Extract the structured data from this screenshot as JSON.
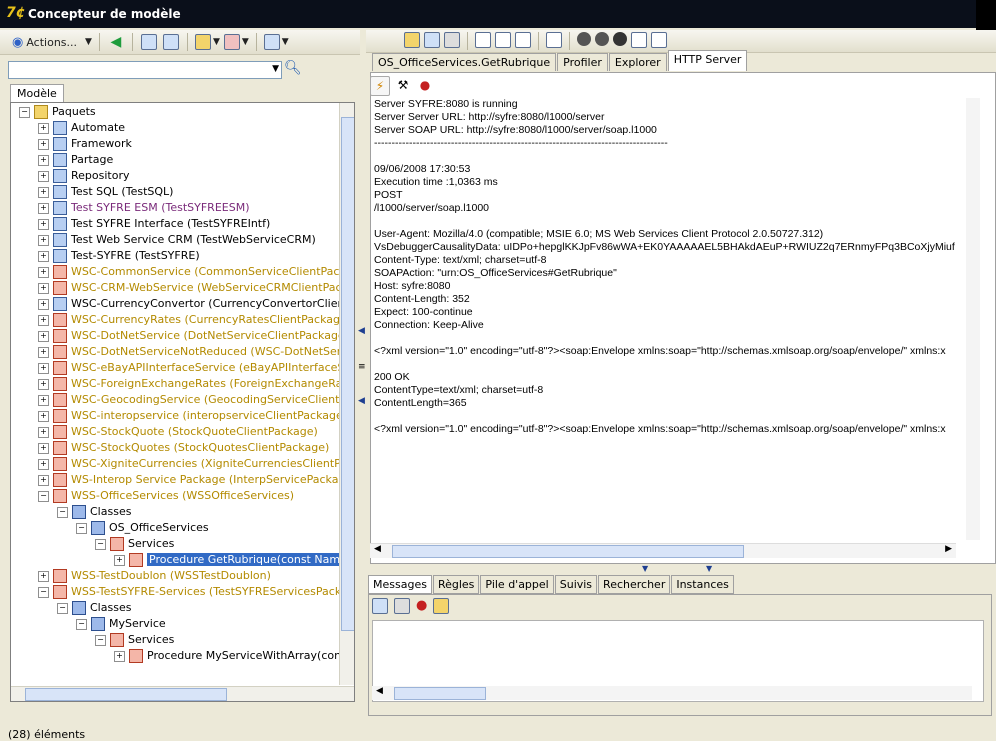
{
  "window": {
    "title": "Concepteur de modèle"
  },
  "left_toolbar": {
    "actions_label": "Actions..."
  },
  "left_tabs": [
    "Modèle"
  ],
  "tree": {
    "root": "Paquets",
    "items": [
      {
        "label": "Automate",
        "style": "normal"
      },
      {
        "label": "Framework",
        "style": "normal"
      },
      {
        "label": "Partage",
        "style": "normal"
      },
      {
        "label": "Repository",
        "style": "normal"
      },
      {
        "label": "Test SQL (TestSQL)",
        "style": "normal"
      },
      {
        "label": "Test SYFRE ESM (TestSYFREESM)",
        "style": "purple"
      },
      {
        "label": "Test SYFRE Interface (TestSYFREIntf)",
        "style": "normal"
      },
      {
        "label": "Test Web Service CRM (TestWebServiceCRM)",
        "style": "normal"
      },
      {
        "label": "Test-SYFRE (TestSYFRE)",
        "style": "normal"
      },
      {
        "label": "WSC-CommonService (CommonServiceClientPackage)",
        "style": "olive"
      },
      {
        "label": "WSC-CRM-WebService (WebServiceCRMClientPackage)",
        "style": "olive"
      },
      {
        "label": "WSC-CurrencyConvertor (CurrencyConvertorClientPackage)",
        "style": "normal"
      },
      {
        "label": "WSC-CurrencyRates (CurrencyRatesClientPackage)",
        "style": "olive"
      },
      {
        "label": "WSC-DotNetService (DotNetServiceClientPackage)",
        "style": "olive"
      },
      {
        "label": "WSC-DotNetServiceNotReduced (WSC-DotNetServiceNotReduced)",
        "style": "olive"
      },
      {
        "label": "WSC-eBayAPIInterfaceService (eBayAPIInterfaceService)",
        "style": "olive"
      },
      {
        "label": "WSC-ForeignExchangeRates (ForeignExchangeRatesClient)",
        "style": "olive"
      },
      {
        "label": "WSC-GeocodingService (GeocodingServiceClientPackage)",
        "style": "olive"
      },
      {
        "label": "WSC-interopservice (interopserviceClientPackage)",
        "style": "olive"
      },
      {
        "label": "WSC-StockQuote (StockQuoteClientPackage)",
        "style": "olive"
      },
      {
        "label": "WSC-StockQuotes (StockQuotesClientPackage)",
        "style": "olive"
      },
      {
        "label": "WSC-XigniteCurrencies (XigniteCurrenciesClientPackage)",
        "style": "olive"
      },
      {
        "label": "WS-Interop Service Package (InterpServicePackage)",
        "style": "olive"
      },
      {
        "label": "WSS-OfficeServices (WSSOfficeServices)",
        "style": "olive"
      },
      {
        "label": "Classes",
        "style": "normal"
      },
      {
        "label": "OS_OfficeServices",
        "style": "normal"
      },
      {
        "label": "Services",
        "style": "normal"
      },
      {
        "label": "Procedure GetRubrique(const Name:string)",
        "style": "selected"
      },
      {
        "label": "WSS-TestDoublon (WSSTestDoublon)",
        "style": "olive"
      },
      {
        "label": "WSS-TestSYFRE-Services (TestSYFREServicesPackage)",
        "style": "olive"
      },
      {
        "label": "Classes",
        "style": "normal"
      },
      {
        "label": "MyService",
        "style": "normal"
      },
      {
        "label": "Services",
        "style": "normal"
      },
      {
        "label": "Procedure MyServiceWithArray(const p",
        "style": "normal"
      }
    ]
  },
  "status": {
    "count": "(28) éléments"
  },
  "right_tabs": [
    {
      "label": "OS_OfficeServices.GetRubrique",
      "active": false
    },
    {
      "label": "Profiler",
      "active": false
    },
    {
      "label": "Explorer",
      "active": false
    },
    {
      "label": "HTTP Server",
      "active": true
    }
  ],
  "http_log": [
    "Server SYFRE:8080 is running",
    "Server Server URL: http://syfre:8080/l1000/server",
    "Server SOAP URL: http://syfre:8080/l1000/server/soap.l1000",
    "------------------------------------------------------------------------------------",
    "",
    "09/06/2008 17:30:53",
    "Execution time :1,0363 ms",
    "POST",
    "/l1000/server/soap.l1000",
    "",
    "User-Agent: Mozilla/4.0 (compatible; MSIE 6.0; MS Web Services Client Protocol 2.0.50727.312)",
    "VsDebuggerCausalityData: uIDPo+hepglKKJpFv86wWA+EK0YAAAAAEL5BHAkdAEuP+RWIUZ2q7ERnmyFPq3BCoXjyMiuf",
    "Content-Type: text/xml; charset=utf-8",
    "SOAPAction: \"urn:OS_OfficeServices#GetRubrique\"",
    "Host: syfre:8080",
    "Content-Length: 352",
    "Expect: 100-continue",
    "Connection: Keep-Alive",
    "",
    "<?xml version=\"1.0\" encoding=\"utf-8\"?><soap:Envelope xmlns:soap=\"http://schemas.xmlsoap.org/soap/envelope/\" xmlns:x",
    "",
    "200 OK",
    "ContentType=text/xml; charset=utf-8",
    "ContentLength=365",
    "",
    "<?xml version=\"1.0\" encoding=\"utf-8\"?><soap:Envelope xmlns:soap=\"http://schemas.xmlsoap.org/soap/envelope/\" xmlns:x"
  ],
  "bottom_tabs": [
    {
      "label": "Messages",
      "active": true
    },
    {
      "label": "Règles",
      "active": false
    },
    {
      "label": "Pile d'appel",
      "active": false
    },
    {
      "label": "Suivis",
      "active": false
    },
    {
      "label": "Rechercher",
      "active": false
    },
    {
      "label": "Instances",
      "active": false
    }
  ]
}
